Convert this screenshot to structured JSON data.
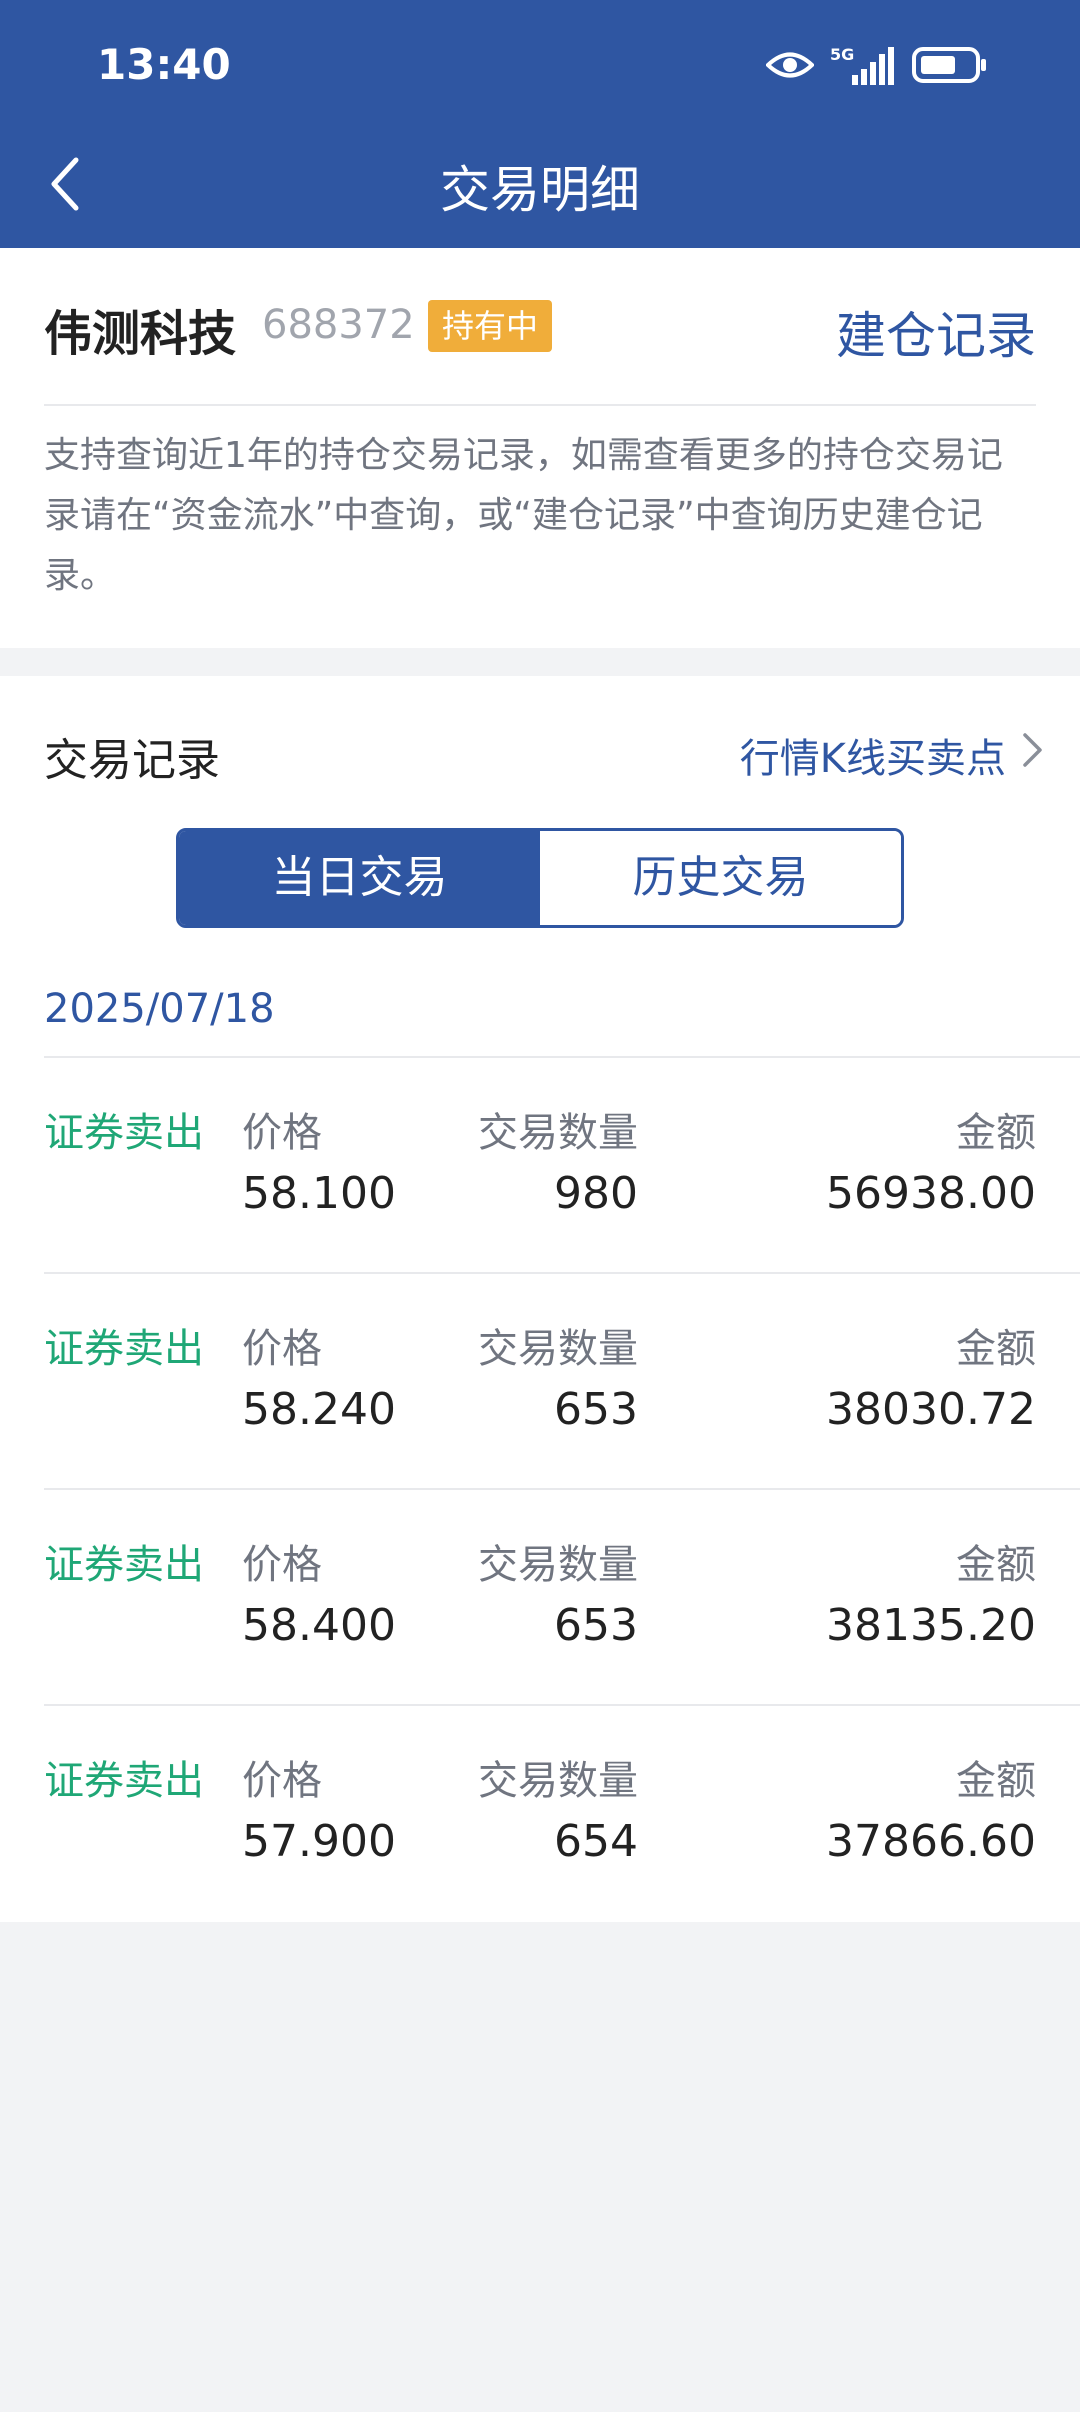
{
  "status_bar": {
    "time": "13:40",
    "network": "5G"
  },
  "header": {
    "title": "交易明细"
  },
  "stock": {
    "name": "伟测科技",
    "code": "688372",
    "badge": "持有中",
    "open_record_link": "建仓记录",
    "notice": "支持查询近1年的持仓交易记录，如需查看更多的持仓交易记录请在“资金流水”中查询，或“建仓记录”中查询历史建仓记录。"
  },
  "trades_section": {
    "title": "交易记录",
    "kline_link": "行情K线买卖点",
    "tabs": [
      "当日交易",
      "历史交易"
    ],
    "date": "2025/07/18",
    "labels": {
      "price": "价格",
      "qty": "交易数量",
      "amount": "金额"
    },
    "rows": [
      {
        "type": "证券卖出",
        "price": "58.100",
        "qty": "980",
        "amount": "56938.00"
      },
      {
        "type": "证券卖出",
        "price": "58.240",
        "qty": "653",
        "amount": "38030.72"
      },
      {
        "type": "证券卖出",
        "price": "58.400",
        "qty": "653",
        "amount": "38135.20"
      },
      {
        "type": "证券卖出",
        "price": "57.900",
        "qty": "654",
        "amount": "37866.60"
      }
    ]
  },
  "colors": {
    "primary": "#2f56a2",
    "sell_green": "#1fa776",
    "badge": "#f0ad3a"
  }
}
